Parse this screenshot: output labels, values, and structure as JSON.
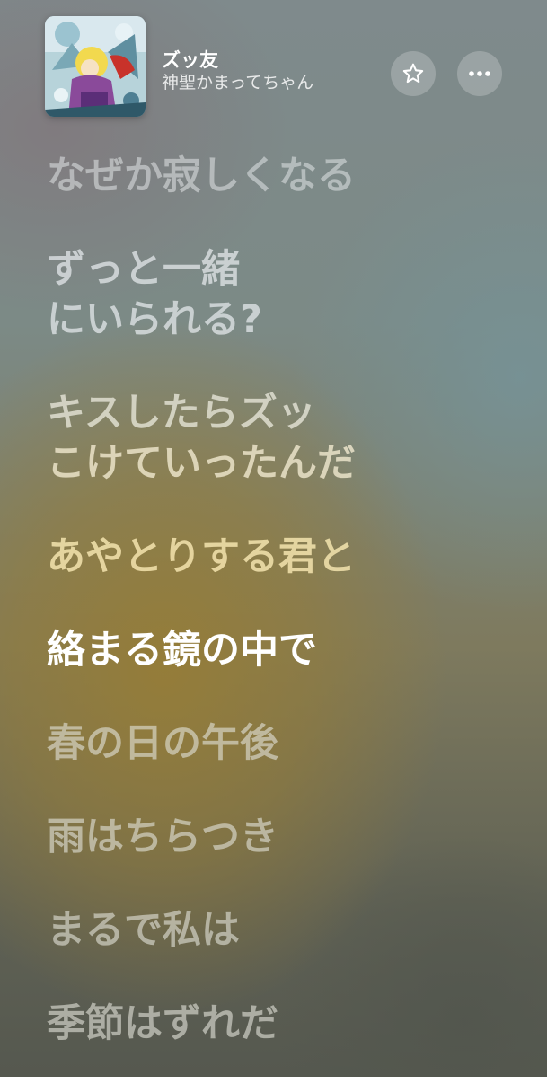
{
  "track": {
    "title": "ズッ友",
    "artist": "神聖かまってちゃん"
  },
  "icons": {
    "favorite": "star-outline-icon",
    "more": "ellipsis-icon"
  },
  "lyrics": [
    {
      "text": "なぜか寂しくなる",
      "state": "past"
    },
    {
      "text": "ずっと一緒",
      "state": "past"
    },
    {
      "text": "にいられる?",
      "state": "past"
    },
    {
      "text": "キスしたらズッ",
      "state": "past"
    },
    {
      "text": "こけていったんだ",
      "state": "past"
    },
    {
      "text": "あやとりする君と",
      "state": "past"
    },
    {
      "text": "絡まる鏡の中で",
      "state": "current"
    },
    {
      "text": "春の日の午後",
      "state": "upcoming"
    },
    {
      "text": "雨はちらつき",
      "state": "upcoming"
    },
    {
      "text": "まるで私は",
      "state": "upcoming"
    },
    {
      "text": "季節はずれだ",
      "state": "upcoming"
    }
  ],
  "colors": {
    "active_lyric": "#ffffff",
    "button_bg": "rgba(255,255,255,0.22)"
  }
}
